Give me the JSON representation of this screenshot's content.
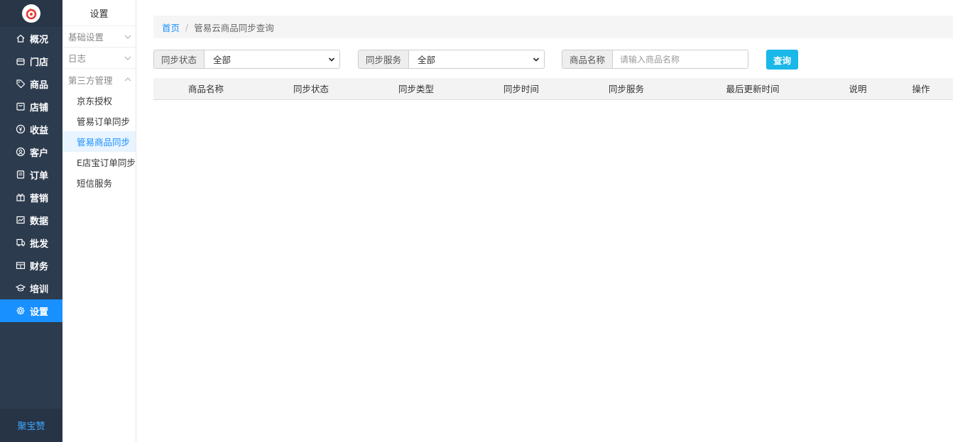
{
  "nav": {
    "items": [
      {
        "label": "概况",
        "icon": "home-icon"
      },
      {
        "label": "门店",
        "icon": "store-icon"
      },
      {
        "label": "商品",
        "icon": "tag-icon"
      },
      {
        "label": "店铺",
        "icon": "shop-icon"
      },
      {
        "label": "收益",
        "icon": "yuan-icon"
      },
      {
        "label": "客户",
        "icon": "user-icon"
      },
      {
        "label": "订单",
        "icon": "order-icon"
      },
      {
        "label": "营销",
        "icon": "gift-icon"
      },
      {
        "label": "数据",
        "icon": "chart-icon"
      },
      {
        "label": "批发",
        "icon": "truck-icon"
      },
      {
        "label": "财务",
        "icon": "finance-icon"
      },
      {
        "label": "培训",
        "icon": "graduation-icon"
      },
      {
        "label": "设置",
        "icon": "gear-icon"
      }
    ],
    "active_index": 12,
    "brand": "聚宝赞",
    "active_color": "#1890ff"
  },
  "subnav": {
    "title": "设置",
    "groups": [
      {
        "label": "基础设置"
      },
      {
        "label": "日志"
      },
      {
        "label": "第三方管理"
      }
    ],
    "items": [
      "京东授权",
      "管易订单同步",
      "管易商品同步",
      "E店宝订单同步",
      "短信服务"
    ],
    "active_item": "管易商品同步"
  },
  "breadcrumb": {
    "home": "首页",
    "separator": "/",
    "current": "管易云商品同步查询"
  },
  "filters": {
    "sync_status": {
      "label": "同步状态",
      "value": "全部"
    },
    "sync_service": {
      "label": "同步服务",
      "value": "全部"
    },
    "product_name": {
      "label": "商品名称",
      "placeholder": "请输入商品名称",
      "value": ""
    },
    "query_label": "查询"
  },
  "table": {
    "columns": [
      "商品名称",
      "同步状态",
      "同步类型",
      "同步时间",
      "同步服务",
      "最后更新时间",
      "说明",
      "操作"
    ],
    "rows": []
  }
}
